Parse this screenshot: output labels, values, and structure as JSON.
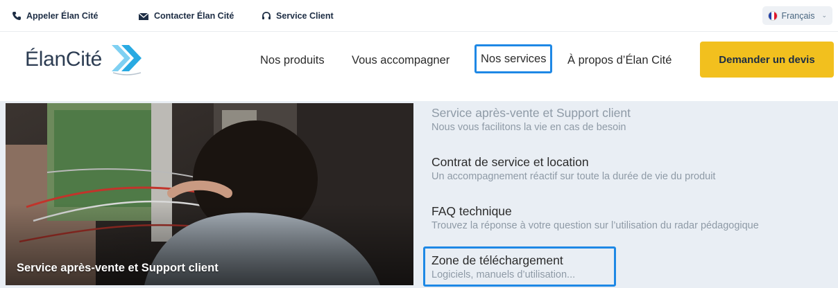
{
  "topbar": {
    "call_label": "Appeler Élan Cité",
    "contact_label": "Contacter Élan Cité",
    "service_label": "Service Client",
    "language": "Français"
  },
  "header": {
    "logo_text": "ÉlanCité",
    "nav": {
      "products": "Nos produits",
      "support": "Vous accompagner",
      "services": "Nos services",
      "about": "À propos d’Élan Cité"
    },
    "cta_label": "Demander un devis"
  },
  "dropdown": {
    "feature_caption": "Service après-vente et Support client",
    "items": [
      {
        "title": "Service après-vente et Support client",
        "desc": "Nous vous facilitons la vie en cas de besoin"
      },
      {
        "title": "Contrat de service et location",
        "desc": "Un accompagnement réactif sur toute la durée de vie du produit"
      },
      {
        "title": "FAQ technique",
        "desc": "Trouvez la réponse à votre question sur l’utilisation du radar pédagogique"
      },
      {
        "title": "Zone de téléchargement",
        "desc": "Logiciels, manuels d’utilisation..."
      }
    ]
  },
  "colors": {
    "accent_yellow": "#f2c01e",
    "highlight_blue": "#1e88e5",
    "logo_blue": "#29aae2",
    "panel_bg": "#e9eef4"
  },
  "icons": [
    "phone-icon",
    "mail-icon",
    "headset-icon",
    "french-flag-icon",
    "chevron-down-icon",
    "logo-chevrons-icon"
  ]
}
